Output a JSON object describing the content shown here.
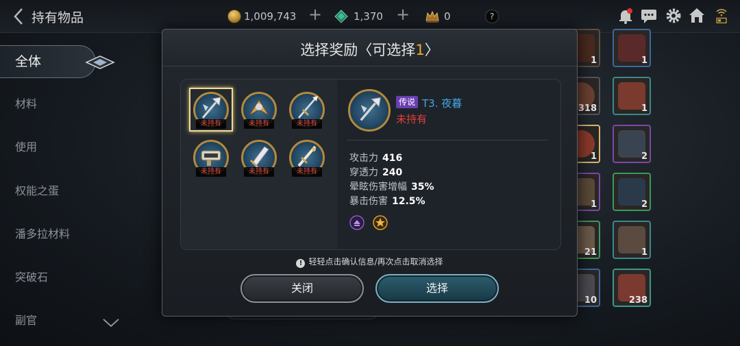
{
  "header": {
    "title": "持有物品",
    "gold": "1,009,743",
    "gems": "1,370",
    "crowns": "0",
    "help": "?"
  },
  "sidebar": {
    "items": [
      {
        "label": "全体"
      },
      {
        "label": "材料"
      },
      {
        "label": "使用"
      },
      {
        "label": "权能之蛋"
      },
      {
        "label": "潘多拉材料"
      },
      {
        "label": "突破石"
      },
      {
        "label": "副官"
      }
    ]
  },
  "inventory": {
    "counts": [
      "1",
      "1",
      "318",
      "1",
      "1",
      "2",
      "1",
      "2",
      "21",
      "1",
      "10",
      "238"
    ]
  },
  "modal": {
    "title_prefix": "选择奖励〈可选择",
    "title_count": "1",
    "title_suffix": "〉",
    "reward_tag": "未持有",
    "selected": {
      "rarity": "传说",
      "name": "T3. 夜暮",
      "status": "未持有",
      "stats": [
        {
          "label": "攻击力",
          "value": "416"
        },
        {
          "label": "穿透力",
          "value": "240"
        },
        {
          "label": "晕眩伤害增幅",
          "value": "35%"
        },
        {
          "label": "暴击伤害",
          "value": "12.5%"
        }
      ]
    },
    "hint": "轻轻点击确认信息/再次点击取消选择",
    "close_label": "关闭",
    "select_label": "选择"
  },
  "colors": {
    "accent_orange": "#f0a830",
    "name_blue": "#44a6e6",
    "not_owned_red": "#e2413a",
    "legend_purple": "#6a3fb2"
  }
}
